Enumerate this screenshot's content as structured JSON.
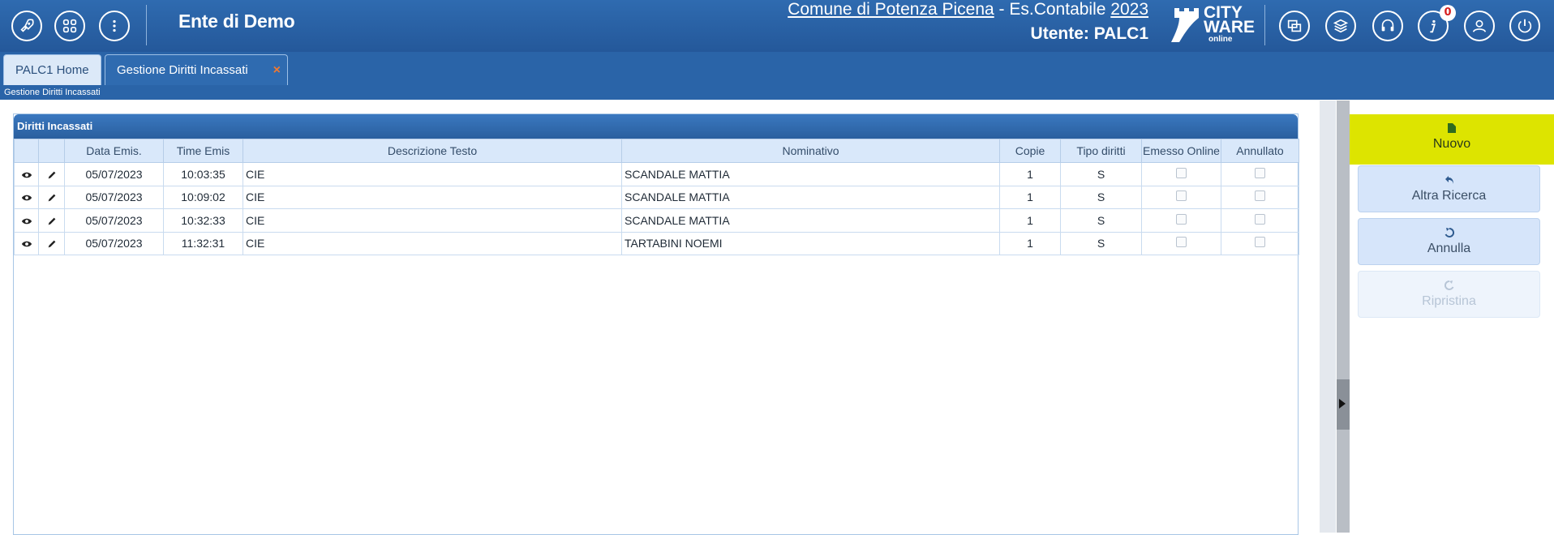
{
  "header": {
    "app_title": "Ente di Demo",
    "ente_name": "Comune di Potenza Picena",
    "ente_separator": " - Es.Contabile ",
    "year": "2023",
    "user_line": "Utente: PALC1",
    "logo_city": "CITY",
    "logo_ware": "WARE",
    "logo_online": "online",
    "notification_count": "0"
  },
  "tabs": [
    {
      "label": "PALC1 Home"
    },
    {
      "label": "Gestione Diritti Incassati",
      "close": "×"
    }
  ],
  "breadcrumb": "Gestione Diritti Incassati",
  "grid": {
    "caption": "Diritti Incassati",
    "columns": [
      "",
      "",
      "Data Emis.",
      "Time Emis",
      "Descrizione Testo",
      "Nominativo",
      "Copie",
      "Tipo diritti",
      "Emesso Online",
      "Annullato"
    ],
    "rows": [
      {
        "data": "05/07/2023",
        "time": "10:03:35",
        "descr": "CIE",
        "nominativo": "SCANDALE MATTIA",
        "copie": "1",
        "tipo": "S"
      },
      {
        "data": "05/07/2023",
        "time": "10:09:02",
        "descr": "CIE",
        "nominativo": "SCANDALE MATTIA",
        "copie": "1",
        "tipo": "S"
      },
      {
        "data": "05/07/2023",
        "time": "10:32:33",
        "descr": "CIE",
        "nominativo": "SCANDALE MATTIA",
        "copie": "1",
        "tipo": "S"
      },
      {
        "data": "05/07/2023",
        "time": "11:32:31",
        "descr": "CIE",
        "nominativo": "TARTABINI NOEMI",
        "copie": "1",
        "tipo": "S"
      }
    ]
  },
  "actions": {
    "nuovo": "Nuovo",
    "altra_ricerca": "Altra Ricerca",
    "annulla": "Annulla",
    "ripristina": "Ripristina"
  },
  "colors": {
    "header_bg": "#2f6bb0",
    "highlight": "#dde400",
    "button_bg": "#d6e5fa",
    "tab_close": "#f07830"
  },
  "icons": [
    "rocket-icon",
    "apps-grid-icon",
    "more-vertical-icon",
    "windows-icon",
    "books-icon",
    "headset-icon",
    "info-icon",
    "user-icon",
    "power-icon",
    "eye-icon",
    "pencil-icon",
    "file-icon",
    "undo-icon",
    "reset-icon"
  ]
}
